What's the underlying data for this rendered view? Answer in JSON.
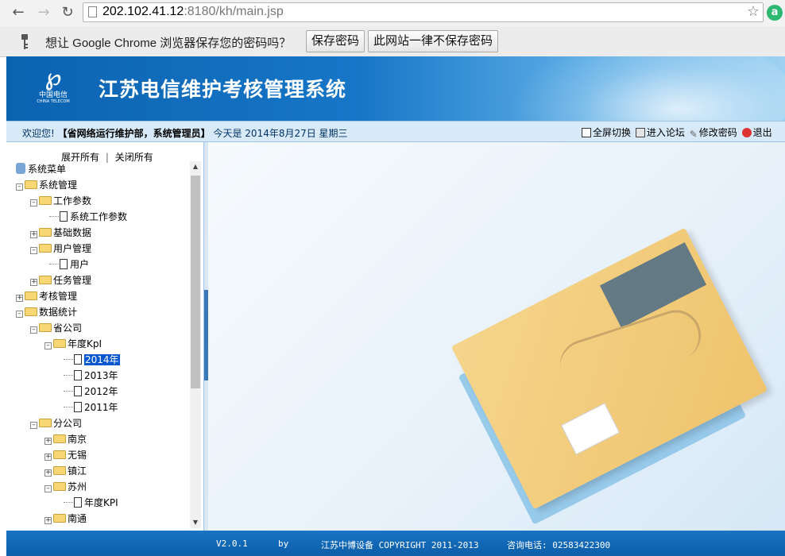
{
  "browser": {
    "url_host": "202.102.41.12",
    "url_rest": ":8180/kh/main.jsp",
    "ext_icon_glyph": "a"
  },
  "password_bar": {
    "message": "想让 Google Chrome 浏览器保存您的密码吗？",
    "save_label": "保存密码",
    "never_label": "此网站一律不保存密码"
  },
  "header": {
    "logo_cn": "中国电信",
    "logo_en": "CHINA TELECOM",
    "title": "江苏电信维护考核管理系统"
  },
  "infobar": {
    "welcome": "欢迎您!",
    "user": "【省网络运行维护部，系统管理员】",
    "today": "今天是 2014年8月27日 星期三",
    "actions": [
      "全屏切换",
      "进入论坛",
      "修改密码",
      "退出"
    ]
  },
  "sidebar": {
    "expand_all": "展开所有",
    "separator": "|",
    "collapse_all": "关闭所有",
    "root": "系统菜单",
    "nodes": [
      {
        "label": "系统管理",
        "kind": "folder",
        "state": "open"
      },
      {
        "label": "工作参数",
        "kind": "folder",
        "state": "open"
      },
      {
        "label": "系统工作参数",
        "kind": "doc"
      },
      {
        "label": "基础数据",
        "kind": "folder",
        "state": "closed"
      },
      {
        "label": "用户管理",
        "kind": "folder",
        "state": "open"
      },
      {
        "label": "用户",
        "kind": "doc"
      },
      {
        "label": "任务管理",
        "kind": "folder",
        "state": "closed"
      },
      {
        "label": "考核管理",
        "kind": "folder",
        "state": "closed"
      },
      {
        "label": "数据统计",
        "kind": "folder",
        "state": "open"
      },
      {
        "label": "省公司",
        "kind": "folder",
        "state": "open"
      },
      {
        "label": "年度KpI",
        "kind": "folder",
        "state": "open"
      },
      {
        "label": "2014年",
        "kind": "doc",
        "selected": true
      },
      {
        "label": "2013年",
        "kind": "doc"
      },
      {
        "label": "2012年",
        "kind": "doc"
      },
      {
        "label": "2011年",
        "kind": "doc"
      },
      {
        "label": "分公司",
        "kind": "folder",
        "state": "open"
      },
      {
        "label": "南京",
        "kind": "folder",
        "state": "closed"
      },
      {
        "label": "无锡",
        "kind": "folder",
        "state": "closed"
      },
      {
        "label": "镇江",
        "kind": "folder",
        "state": "closed"
      },
      {
        "label": "苏州",
        "kind": "folder",
        "state": "open"
      },
      {
        "label": "年度KPI",
        "kind": "doc"
      },
      {
        "label": "南通",
        "kind": "folder",
        "state": "closed"
      }
    ]
  },
  "footer": {
    "version": "V2.0.1",
    "by": "by",
    "copyright": "江苏中博设备 COPYRIGHT 2011-2013",
    "phone": "咨询电话: 02583422300"
  },
  "colors": {
    "banner_blue": "#1776c7",
    "selection": "#0a58d0",
    "footer_blue": "#0c5ea8"
  }
}
